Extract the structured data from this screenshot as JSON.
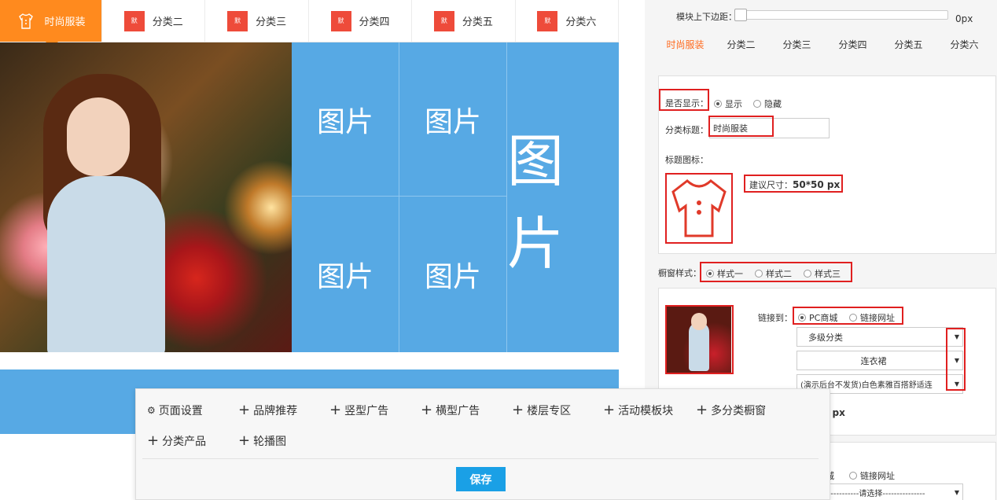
{
  "preview": {
    "tabs": [
      {
        "label": "时尚服装",
        "icon": "shirt-icon",
        "active": true
      },
      {
        "label": "分类二",
        "icon": "category-thumb-icon",
        "active": false
      },
      {
        "label": "分类三",
        "icon": "category-thumb-icon",
        "active": false
      },
      {
        "label": "分类四",
        "icon": "category-thumb-icon",
        "active": false
      },
      {
        "label": "分类五",
        "icon": "category-thumb-icon",
        "active": false
      },
      {
        "label": "分类六",
        "icon": "category-thumb-icon",
        "active": false
      }
    ],
    "tab_icon_text": "默",
    "placeholders": [
      "图片",
      "图片",
      "图片",
      "图片",
      "图片"
    ],
    "colors": {
      "accent": "#ff8a1e",
      "tile": "#57a9e4",
      "icon_bg": "#ee4b3a"
    }
  },
  "config": {
    "margin_label": "模块上下边距：",
    "margin_value": "0px",
    "tabs": [
      "时尚服装",
      "分类二",
      "分类三",
      "分类四",
      "分类五",
      "分类六"
    ],
    "active_tab": "时尚服装",
    "show_label": "是否显示：",
    "show_option": "显示",
    "hide_option": "隐藏",
    "title_label": "分类标题：",
    "title_value": "时尚服装",
    "icon_label": "标题图标：",
    "size_hint_prefix": "建议尺寸：",
    "size_hint_value": "50*50 px",
    "style_label": "橱窗样式：",
    "style_options": [
      "样式一",
      "样式二",
      "样式三"
    ],
    "link_label": "链接到：",
    "link_options": [
      "PC商城",
      "链接网址"
    ],
    "select_category": "多级分类",
    "select_subcategory": "连衣裙",
    "select_product": "(演示后台不发货)白色素雅百搭舒适连",
    "partial_size": "0 px",
    "link2_partial": "城",
    "link2_option": "链接网址",
    "select_placeholder": "-------------请选择---------------"
  },
  "toolbar": {
    "items": [
      {
        "label": "页面设置",
        "icon": "gear-icon"
      },
      {
        "label": "品牌推荐",
        "icon": "plus-icon"
      },
      {
        "label": "竖型广告",
        "icon": "plus-icon"
      },
      {
        "label": "横型广告",
        "icon": "plus-icon"
      },
      {
        "label": "楼层专区",
        "icon": "plus-icon"
      },
      {
        "label": "活动模板块",
        "icon": "plus-icon"
      },
      {
        "label": "多分类橱窗",
        "icon": "plus-icon"
      },
      {
        "label": "分类产品",
        "icon": "plus-icon"
      },
      {
        "label": "轮播图",
        "icon": "plus-icon"
      }
    ],
    "save_label": "保存"
  }
}
